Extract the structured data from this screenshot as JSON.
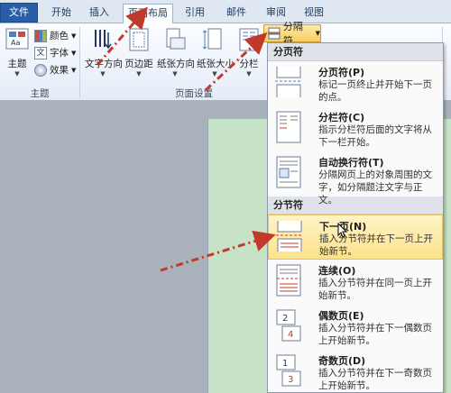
{
  "tabs": [
    {
      "label": "文件"
    },
    {
      "label": "开始"
    },
    {
      "label": "插入"
    },
    {
      "label": "页面布局"
    },
    {
      "label": "引用"
    },
    {
      "label": "邮件"
    },
    {
      "label": "审阅"
    },
    {
      "label": "视图"
    }
  ],
  "ribbon": {
    "theme_group": {
      "themes_label": "主题",
      "colors_label": "颜色",
      "fonts_label": "字体",
      "effects_label": "效果",
      "group_label": "主题"
    },
    "page_setup": {
      "text_direction": "文字方向",
      "margins": "页边距",
      "orientation": "纸张方向",
      "size": "纸张大小",
      "columns": "分栏",
      "group_label": "页面设置"
    },
    "breaks_button": "分隔符"
  },
  "menu": {
    "page_breaks_header": "分页符",
    "section_breaks_header": "分节符",
    "items": [
      {
        "title": "分页符(P)",
        "desc": "标记一页终止并开始下一页的点。"
      },
      {
        "title": "分栏符(C)",
        "desc": "指示分栏符后面的文字将从下一栏开始。"
      },
      {
        "title": "自动换行符(T)",
        "desc": "分隔网页上的对象周围的文字，如分隔题注文字与正文。"
      },
      {
        "title": "下一页(N)",
        "desc": "插入分节符并在下一页上开始新节。"
      },
      {
        "title": "连续(O)",
        "desc": "插入分节符并在同一页上开始新节。"
      },
      {
        "title": "偶数页(E)",
        "desc": "插入分节符并在下一偶数页上开始新节。"
      },
      {
        "title": "奇数页(D)",
        "desc": "插入分节符并在下一奇数页上开始新节。"
      }
    ]
  },
  "colors": {
    "file_tab": "#2a5da8",
    "highlight": "#fde28b",
    "arrow": "#c0392b",
    "document_bg": "#c6e3c8"
  }
}
